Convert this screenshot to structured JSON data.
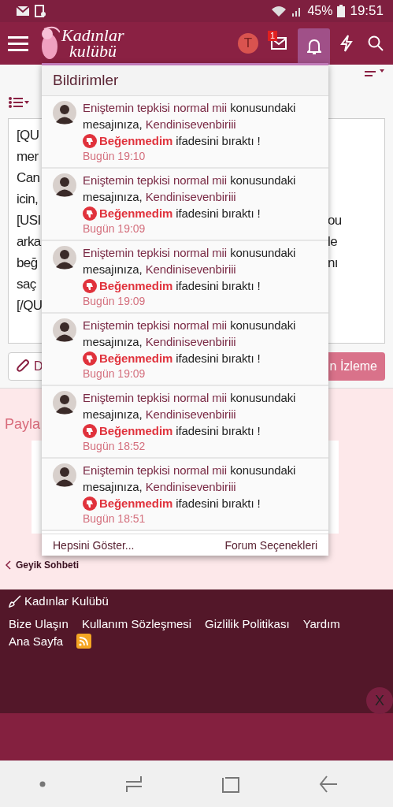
{
  "status_bar": {
    "battery": "45%",
    "time": "19:51"
  },
  "header": {
    "logo_line_1": "Kadınlar",
    "logo_line_2": "kulübü",
    "avatar_letter": "T",
    "messages_badge": "1",
    "notifications_open": true
  },
  "editor": {
    "lines": [
      {
        "left": "[QU"
      },
      {
        "left": "mer"
      },
      {
        "left": "Can"
      },
      {
        "left": "icin,"
      },
      {
        "left": "[USI",
        "right": "ou"
      },
      {
        "left": "arka",
        "right": "le"
      },
      {
        "left": "beğ",
        "right": "nı"
      },
      {
        "left": "saç"
      },
      {
        "left": "[/QU"
      }
    ],
    "attach_button": "D",
    "preview_button": "n İzleme"
  },
  "share_label": "Payla",
  "breadcrumb": "Geyik Sohbeti",
  "notifications": {
    "title": "Bildirimler",
    "items": [
      {
        "thread": "Eniştemin tepkisi normal mii",
        "text_1": "konusundaki",
        "text_2": "mesajınıza,",
        "user": "Kendinisevenbiriii",
        "reaction": "Beğenmedim",
        "text_3": "ifadesini bıraktı !",
        "time": "Bugün 19:10"
      },
      {
        "thread": "Eniştemin tepkisi normal mii",
        "text_1": "konusundaki",
        "text_2": "mesajınıza,",
        "user": "Kendinisevenbiriii",
        "reaction": "Beğenmedim",
        "text_3": "ifadesini bıraktı !",
        "time": "Bugün 19:09"
      },
      {
        "thread": "Eniştemin tepkisi normal mii",
        "text_1": "konusundaki",
        "text_2": "mesajınıza,",
        "user": "Kendinisevenbiriii",
        "reaction": "Beğenmedim",
        "text_3": "ifadesini bıraktı !",
        "time": "Bugün 19:09"
      },
      {
        "thread": "Eniştemin tepkisi normal mii",
        "text_1": "konusundaki",
        "text_2": "mesajınıza,",
        "user": "Kendinisevenbiriii",
        "reaction": "Beğenmedim",
        "text_3": "ifadesini bıraktı !",
        "time": "Bugün 19:09"
      },
      {
        "thread": "Eniştemin tepkisi normal mii",
        "text_1": "konusundaki",
        "text_2": "mesajınıza,",
        "user": "Kendinisevenbiriii",
        "reaction": "Beğenmedim",
        "text_3": "ifadesini bıraktı !",
        "time": "Bugün 18:52"
      },
      {
        "thread": "Eniştemin tepkisi normal mii",
        "text_1": "konusundaki",
        "text_2": "mesajınıza,",
        "user": "Kendinisevenbiriii",
        "reaction": "Beğenmedim",
        "text_3": "ifadesini bıraktı !",
        "time": "Bugün 18:51"
      }
    ],
    "show_all": "Hepsini Göster...",
    "options": "Forum Seçenekleri"
  },
  "footer": {
    "brand": "Kadınlar Kulübü",
    "links": [
      "Bize Ulaşın",
      "Kullanım Sözleşmesi",
      "Gizlilik Politikası",
      "Yardım",
      "Ana Sayfa"
    ],
    "close": "X"
  }
}
